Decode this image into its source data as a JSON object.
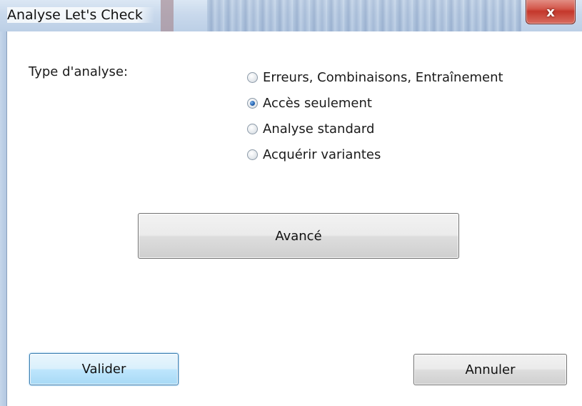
{
  "window": {
    "title": "Analyse Let's Check",
    "close_label": "x"
  },
  "form": {
    "type_label": "Type d'analyse:",
    "options": [
      {
        "label": "Erreurs, Combinaisons, Entraînement",
        "checked": false
      },
      {
        "label": "Accès seulement",
        "checked": true
      },
      {
        "label": "Analyse standard",
        "checked": false
      },
      {
        "label": "Acquérir variantes",
        "checked": false
      }
    ]
  },
  "buttons": {
    "advanced": "Avancé",
    "validate": "Valider",
    "cancel": "Annuler"
  }
}
